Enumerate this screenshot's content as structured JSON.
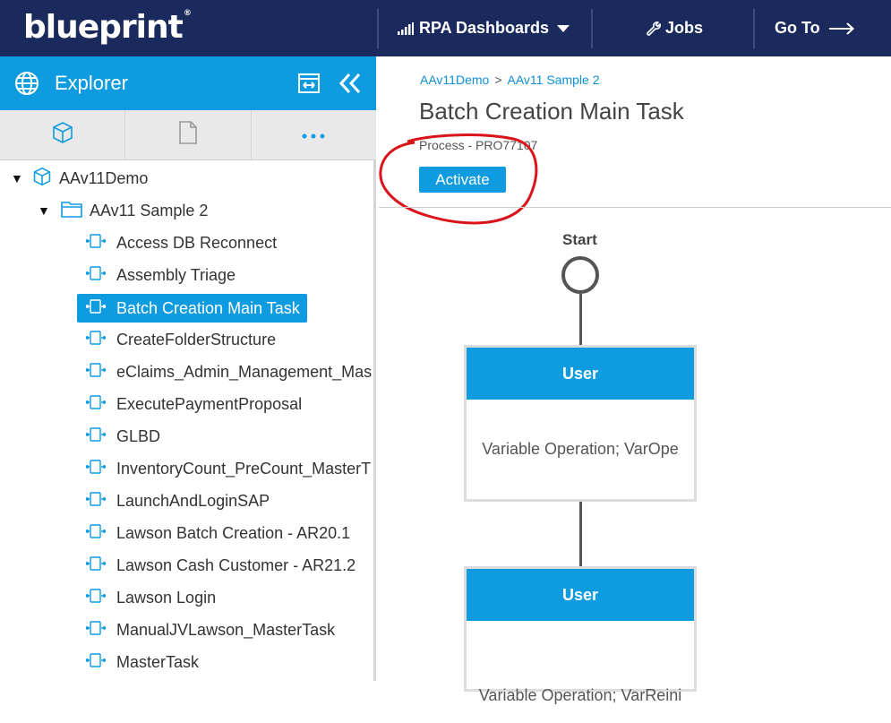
{
  "topbar": {
    "logo": "blueprint",
    "rpa_dashboards": "RPA Dashboards",
    "jobs": "Jobs",
    "goto": "Go To"
  },
  "explorer": {
    "title": "Explorer"
  },
  "tree": {
    "root": "AAv11Demo",
    "folder": "AAv11 Sample 2",
    "items": [
      "Access DB Reconnect",
      "Assembly Triage",
      "Batch Creation Main Task",
      "CreateFolderStructure",
      "eClaims_Admin_Management_Mas",
      "ExecutePaymentProposal",
      "GLBD",
      "InventoryCount_PreCount_MasterT",
      "LaunchAndLoginSAP",
      "Lawson Batch Creation - AR20.1",
      "Lawson Cash Customer - AR21.2",
      "Lawson Login",
      "ManualJVLawson_MasterTask",
      "MasterTask"
    ],
    "selected_index": 2
  },
  "main": {
    "breadcrumb": [
      "AAv11Demo",
      "AAv11 Sample 2"
    ],
    "breadcrumb_sep": ">",
    "title": "Batch Creation Main Task",
    "subtitle": "Process - PRO77107",
    "activate": "Activate"
  },
  "flow": {
    "start": "Start",
    "tasks": [
      {
        "head": "User",
        "body": "Variable Operation; VarOpe"
      },
      {
        "head": "User",
        "body": "Variable Operation; VarReini"
      }
    ]
  },
  "colors": {
    "topbar": "#1a2a5c",
    "accent": "#0f9be0",
    "annotation": "#d9141b"
  }
}
